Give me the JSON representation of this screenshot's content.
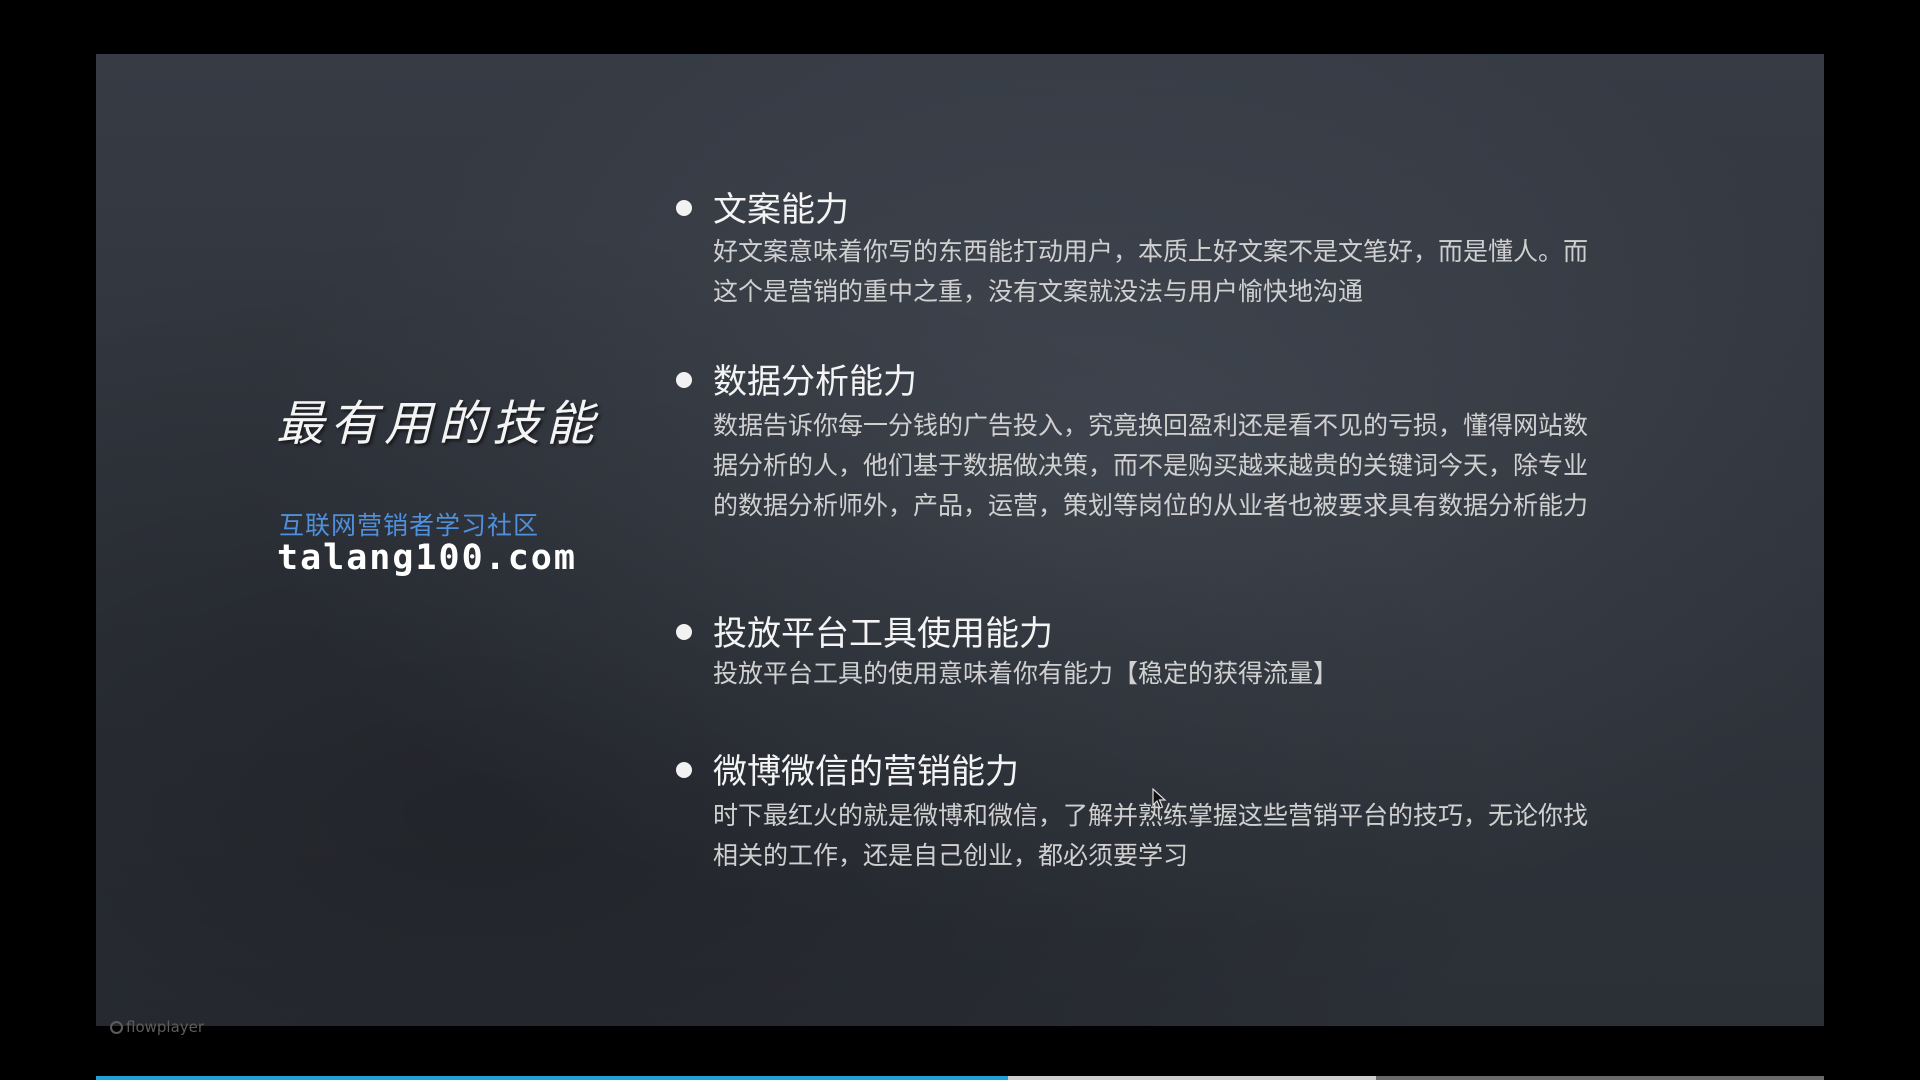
{
  "slide": {
    "title": "最有用的技能",
    "community": "互联网营销者学习社区",
    "url": "talang100.com",
    "bullets": [
      {
        "title": "文案能力",
        "desc": "好文案意味着你写的东西能打动用户，本质上好文案不是文笔好，而是懂人。而这个是营销的重中之重，没有文案就没法与用户愉快地沟通"
      },
      {
        "title": "数据分析能力",
        "desc": "数据告诉你每一分钱的广告投入，究竟换回盈利还是看不见的亏损，懂得网站数据分析的人，他们基于数据做决策，而不是购买越来越贵的关键词今天，除专业的数据分析师外，产品，运营，策划等岗位的从业者也被要求具有数据分析能力"
      },
      {
        "title": "投放平台工具使用能力",
        "desc": "投放平台工具的使用意味着你有能力【稳定的获得流量】"
      },
      {
        "title": "微博微信的营销能力",
        "desc": "时下最红火的就是微博和微信，了解并熟练掌握这些营销平台的技巧，无论你找相关的工作，还是自己创业，都必须要学习"
      }
    ]
  },
  "player": {
    "brand": "flowplayer",
    "progress_fraction": 0.528,
    "buffered_fraction": 0.741,
    "colors": {
      "progress": "#1ea0d8",
      "buffer": "#cfcfcf",
      "track": "#6a6a6a"
    }
  }
}
